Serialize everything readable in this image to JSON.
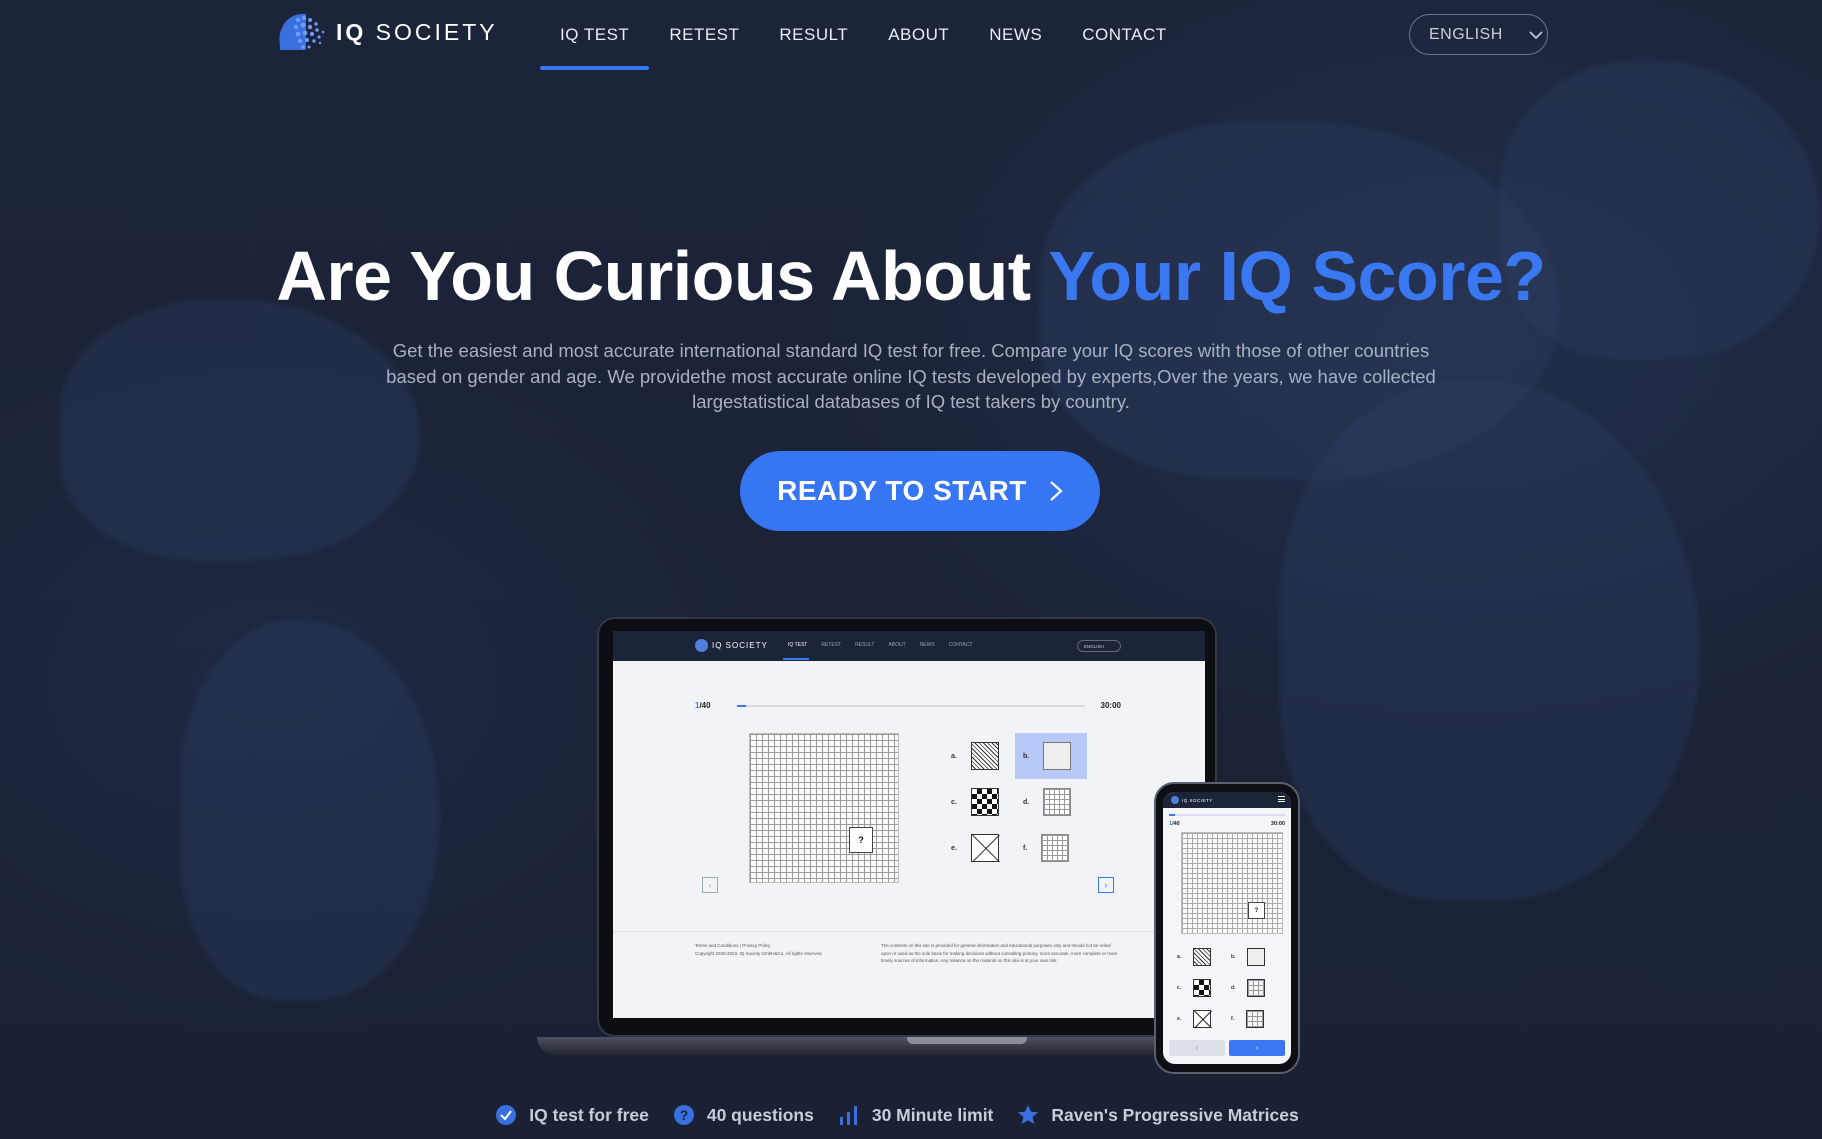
{
  "brand": {
    "name_bold": "IQ",
    "name_rest": "SOCIETY",
    "accent_color": "#3a78f2"
  },
  "nav": {
    "items": [
      {
        "label": "IQ TEST",
        "active": true
      },
      {
        "label": "RETEST",
        "active": false
      },
      {
        "label": "RESULT",
        "active": false
      },
      {
        "label": "ABOUT",
        "active": false
      },
      {
        "label": "NEWS",
        "active": false
      },
      {
        "label": "CONTACT",
        "active": false
      }
    ],
    "language": "ENGLISH"
  },
  "hero": {
    "title_plain": "Are You Curious About ",
    "title_accent": "Your IQ Score?",
    "description": "Get the easiest and most accurate international standard IQ test for free. Compare your IQ scores with those of other countries based on gender and age. We providethe most accurate online IQ tests developed by experts,Over the years, we have collected largestatistical databases of IQ test takers by country.",
    "cta_label": "READY TO START"
  },
  "preview": {
    "brand": "IQ SOCIETY",
    "menu": [
      "IQ TEST",
      "RETEST",
      "RESULT",
      "ABOUT",
      "NEWS",
      "CONTACT"
    ],
    "language": "ENGLISH",
    "current_question": "1",
    "total_questions": "/40",
    "progress": 0.025,
    "timer": "30:00",
    "question_mark": "?",
    "options": [
      "a.",
      "b.",
      "c.",
      "d.",
      "e.",
      "f."
    ],
    "selected_option": "b.",
    "footer_links": "Terms and Conditions   |   Privacy Policy",
    "footer_copyright": "Copyright 2020-2023. IQ Society GmbH&Co. All rights reserved.",
    "footer_disclaimer": "The contents on this site is provided for general information and educational purposes only and should not be relied upon or used as the sole basis for making decisions without consulting primary, more accurate, more complete or more timely sources of information. Any reliance on the material on this site is at your own risk."
  },
  "features": [
    {
      "icon": "check-circle-icon",
      "label": "IQ test for free"
    },
    {
      "icon": "question-circle-icon",
      "label": "40 questions"
    },
    {
      "icon": "bar-chart-icon",
      "label": "30 Minute limit"
    },
    {
      "icon": "star-icon",
      "label": "Raven's Progressive Matrices"
    }
  ]
}
